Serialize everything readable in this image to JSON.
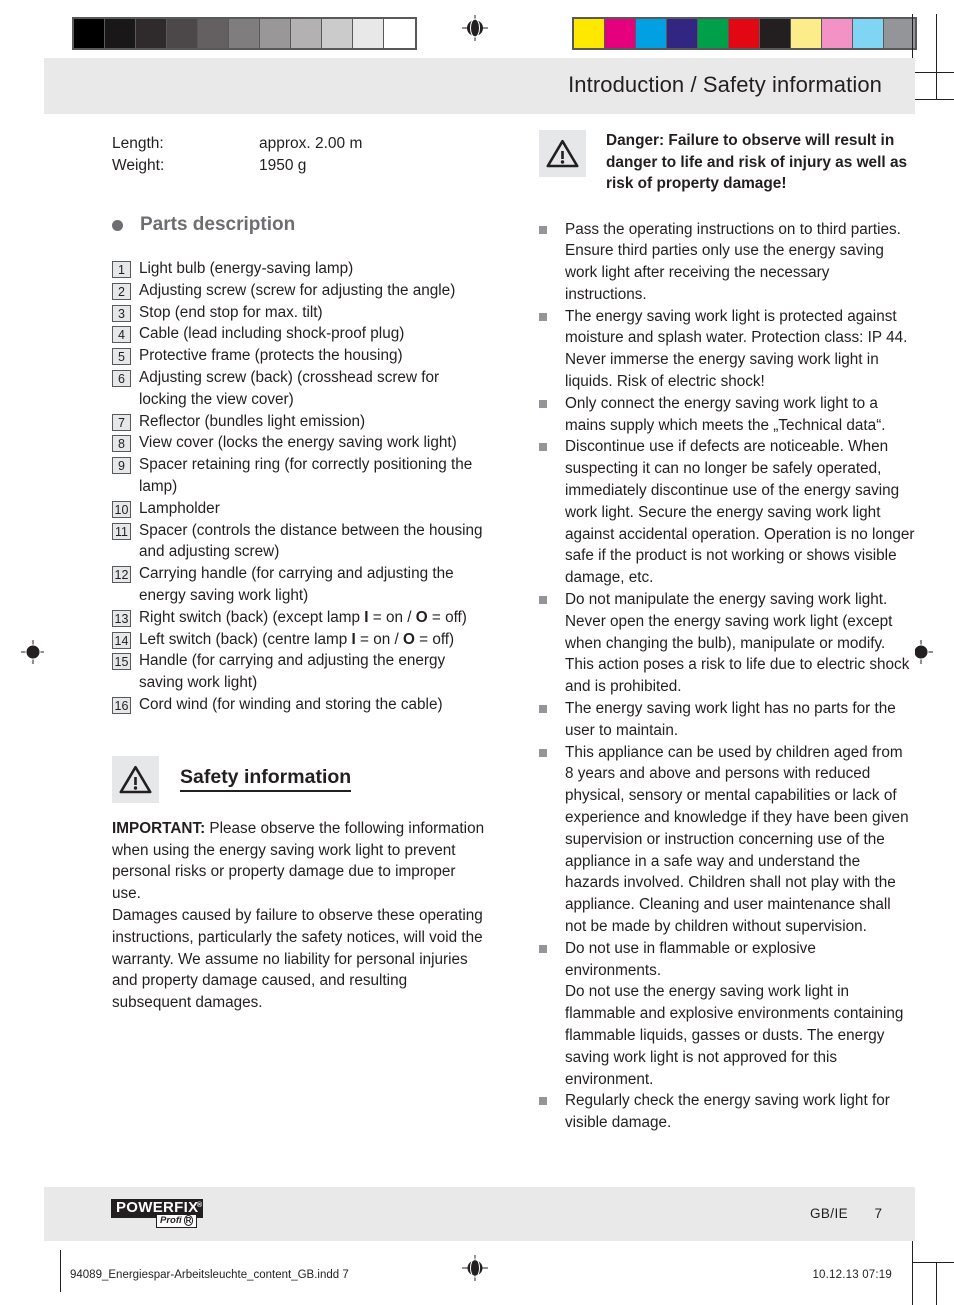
{
  "prepress": {
    "grayscale_patches": [
      "#000000",
      "#1a1718",
      "#2f2b2c",
      "#4c4849",
      "#646061",
      "#807d7e",
      "#9a9798",
      "#b3b1b2",
      "#cccbcb",
      "#e8e8e8",
      "#ffffff"
    ],
    "colorbar_patches": [
      "#ffe800",
      "#e5007e",
      "#00a0e3",
      "#312783",
      "#00a04a",
      "#e30613",
      "#231f20",
      "#fced8a",
      "#f392c4",
      "#80d5f5",
      "#939598"
    ],
    "registration_mark": "registration-crosshair"
  },
  "header": {
    "title": "Introduction / Safety information"
  },
  "left_column": {
    "specs": [
      {
        "label": "Length:",
        "value": "approx. 2.00 m"
      },
      {
        "label": "Weight:",
        "value": "1950 g"
      }
    ],
    "parts_heading": "Parts description",
    "parts": [
      {
        "num": "1",
        "text": "Light bulb (energy-saving lamp)"
      },
      {
        "num": "2",
        "text": "Adjusting screw (screw for adjusting the angle)"
      },
      {
        "num": "3",
        "text": "Stop (end stop for max. tilt)"
      },
      {
        "num": "4",
        "text": "Cable (lead including shock-proof plug)"
      },
      {
        "num": "5",
        "text": "Protective frame (protects the housing)"
      },
      {
        "num": "6",
        "text": "Adjusting screw (back) (crosshead screw for locking the view cover)"
      },
      {
        "num": "7",
        "text": "Reflector (bundles light emission)"
      },
      {
        "num": "8",
        "text": "View cover (locks the energy saving work light)"
      },
      {
        "num": "9",
        "text": "Spacer retaining ring (for correctly positioning the lamp)"
      },
      {
        "num": "10",
        "text": "Lampholder"
      },
      {
        "num": "11",
        "text": "Spacer (controls the distance between the housing and adjusting screw)"
      },
      {
        "num": "12",
        "text": "Carrying handle (for carrying and adjusting the energy saving work light)"
      },
      {
        "num": "13",
        "text": "Right switch (back) (except lamp I = on / O = off)"
      },
      {
        "num": "14",
        "text": "Left switch (back) (centre lamp I = on / O = off)"
      },
      {
        "num": "15",
        "text": "Handle (for carrying and adjusting the energy saving work light)"
      },
      {
        "num": "16",
        "text": "Cord wind (for winding and storing the cable)"
      }
    ],
    "safety_heading": "Safety information",
    "safety_icon": "warning-triangle-icon",
    "important_label": "IMPORTANT:",
    "important_text": " Please observe the following information when using the energy saving work light to prevent personal risks or property damage due to improper use.",
    "liability_text": "Damages caused by failure to observe these operating instructions, particularly the safety notices, will void the warranty. We assume no liability for personal injuries and property damage caused, and resulting subsequent damages."
  },
  "right_column": {
    "danger_icon": "warning-triangle-icon",
    "danger_text": "Danger: Failure to observe will result in danger to life and risk of injury as well as risk of property damage!",
    "notices": [
      "Pass the operating instructions on to third parties. Ensure third parties only use the energy saving work light after receiving the necessary instructions.",
      "The energy saving work light is protected against moisture and splash water. Protection class: IP 44. Never immerse the energy saving work light in liquids. Risk of electric shock!",
      "Only connect the energy saving work light to a mains supply which meets the „Technical data“.",
      "Discontinue use if defects are noticeable. When suspecting it can no longer be safely operated, immediately discontinue use of the energy saving work light. Secure the energy saving work light against accidental operation. Operation is no longer safe if the product is not working or shows visible damage, etc.",
      "Do not manipulate the energy saving work light. Never open the energy saving work light (except when changing the bulb), manipulate or modify. This action poses a risk to life due to electric shock and is prohibited.",
      "The energy saving work light has no parts for the user to maintain.",
      "This appliance can be used by children aged from 8 years and above and persons with reduced physical, sensory or mental capabilities or lack of experience and knowledge if they have been given supervision or instruction concerning use of the appliance in a safe way and understand the hazards involved. Children shall not play with the appliance. Cleaning and user maintenance shall not be made by children without supervision.",
      "Do not use in flammable or explosive environments.",
      "Regularly check the energy saving work light for visible damage."
    ],
    "notice_8_continuation": "Do not use the energy saving work light in flammable and explosive environments containing flammable liquids, gasses or dusts. The energy saving work light is not approved for this environment."
  },
  "footer": {
    "brand_name": "POWERFIX",
    "brand_reg": "®",
    "brand_sub": "Profi",
    "brand_sub_reg": "R",
    "locale": "GB/IE",
    "page_number": "7"
  },
  "print_footer": {
    "filename": "94089_Energiespar-Arbeitsleuchte_content_GB.indd   7",
    "datetime": "10.12.13   07:19"
  }
}
